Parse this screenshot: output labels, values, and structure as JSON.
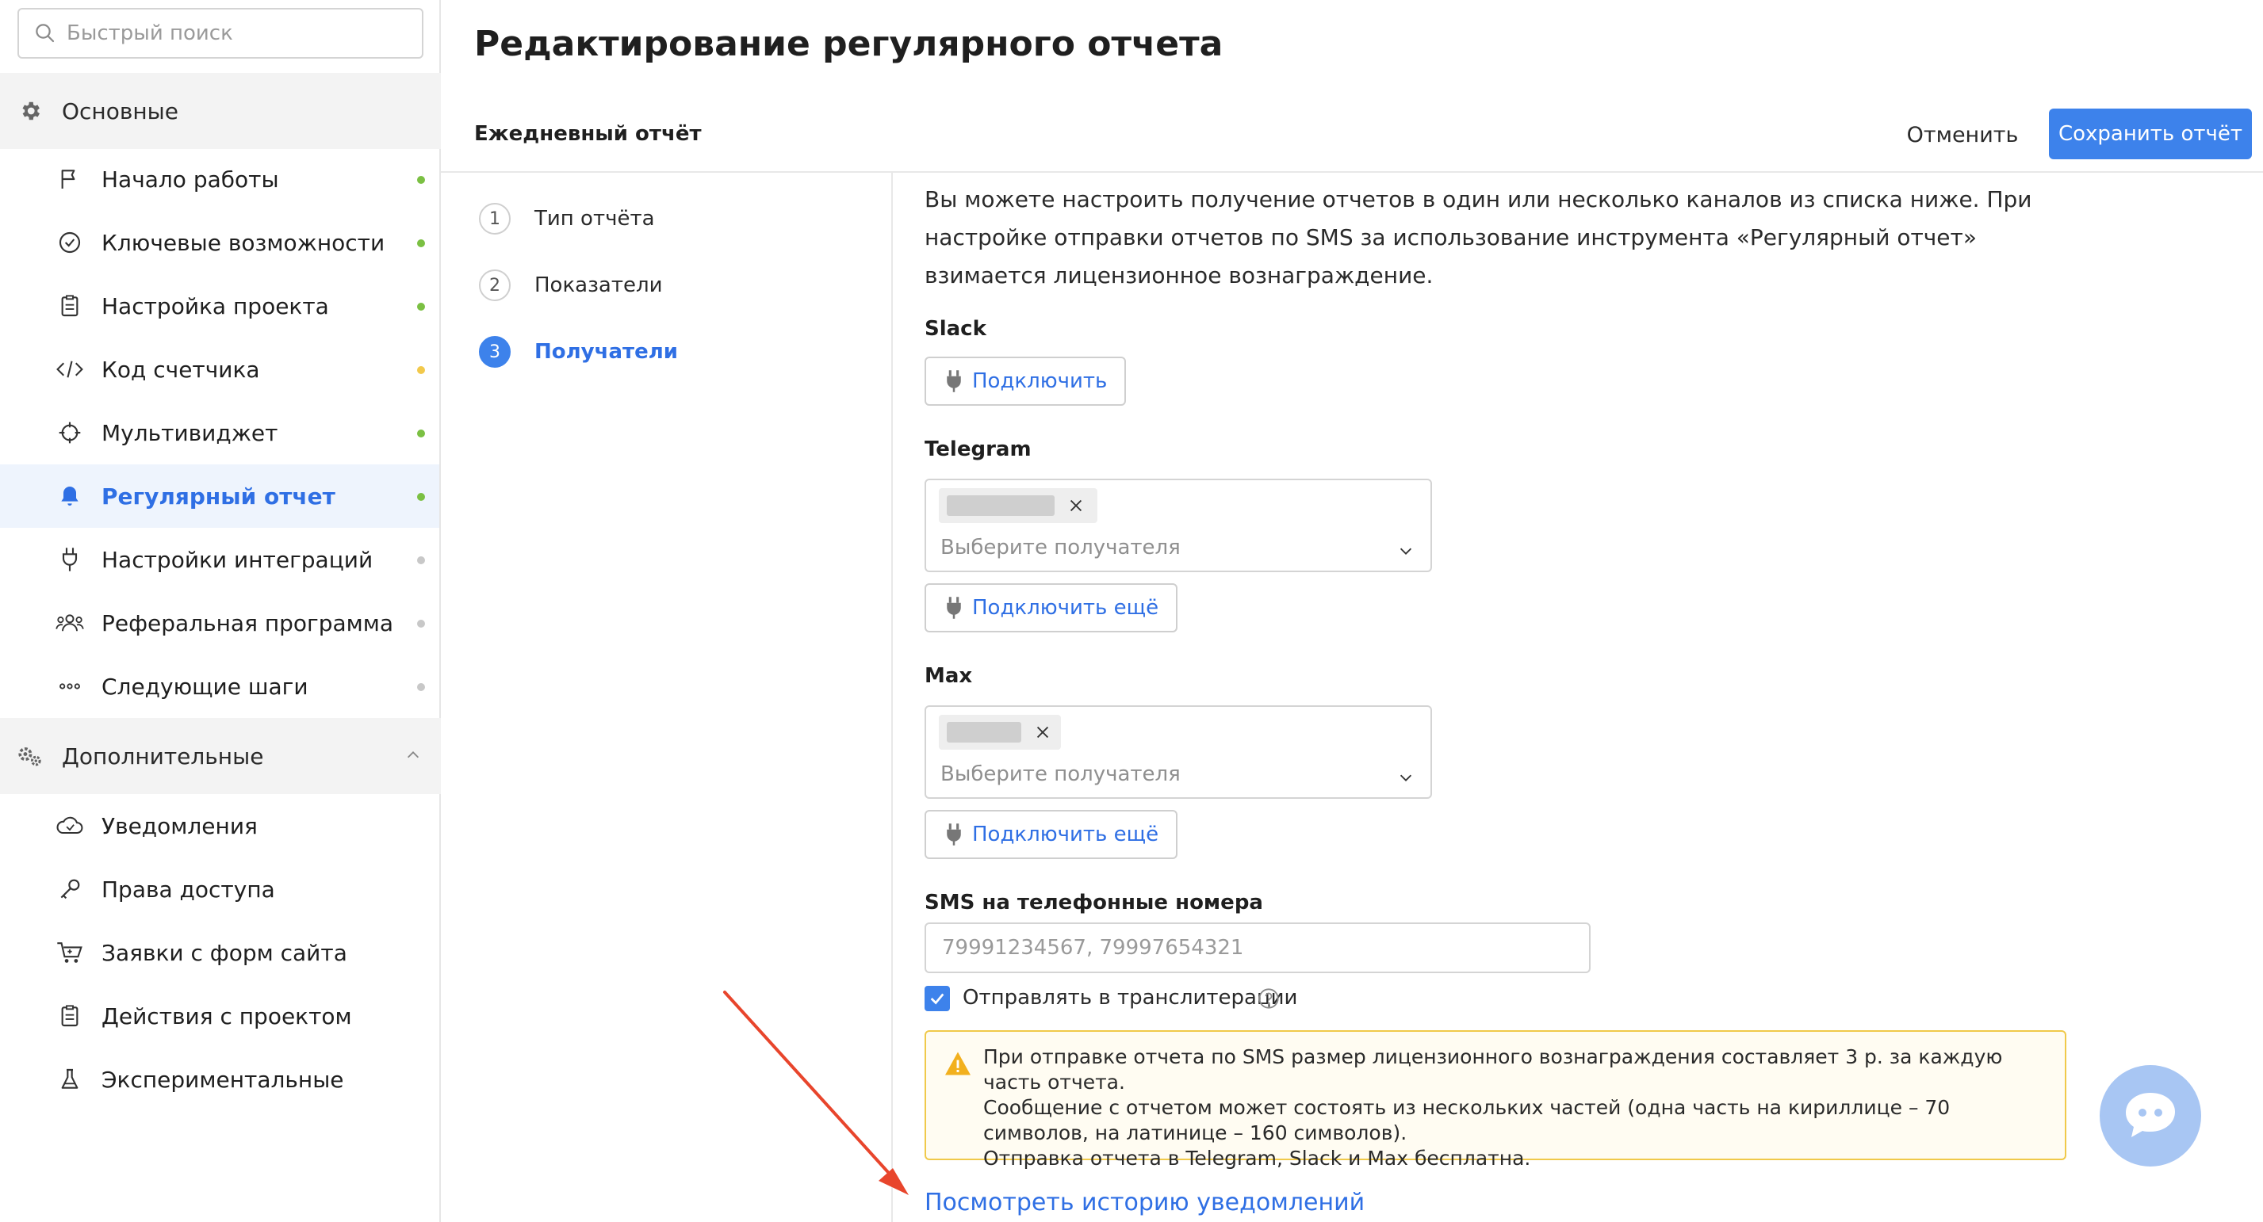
{
  "sidebar": {
    "search_placeholder": "Быстрый поиск",
    "section_main": "Основные",
    "section_extra": "Дополнительные",
    "main_items": [
      {
        "label": "Начало работы",
        "icon": "flag-icon",
        "dot": "#7bc043"
      },
      {
        "label": "Ключевые возможности",
        "icon": "check-circle-icon",
        "dot": "#7bc043"
      },
      {
        "label": "Настройка проекта",
        "icon": "clipboard-icon",
        "dot": "#7bc043"
      },
      {
        "label": "Код счетчика",
        "icon": "code-icon",
        "dot": "#f2c94c"
      },
      {
        "label": "Мультивиджет",
        "icon": "crosshair-icon",
        "dot": "#7bc043"
      },
      {
        "label": "Регулярный отчет",
        "icon": "bell-icon",
        "dot": "#7bc043",
        "active": true
      },
      {
        "label": "Настройки интеграций",
        "icon": "plug-icon",
        "dot": "#c8c8c8"
      },
      {
        "label": "Реферальная программа",
        "icon": "users-icon",
        "dot": "#c8c8c8"
      },
      {
        "label": "Следующие шаги",
        "icon": "dots-icon",
        "dot": "#c8c8c8"
      }
    ],
    "extra_items": [
      {
        "label": "Уведомления",
        "icon": "cloud-icon"
      },
      {
        "label": "Права доступа",
        "icon": "key-icon"
      },
      {
        "label": "Заявки с форм сайта",
        "icon": "cart-icon"
      },
      {
        "label": "Действия с проектом",
        "icon": "clipboard-icon"
      },
      {
        "label": "Экспериментальные",
        "icon": "flask-icon"
      }
    ]
  },
  "header": {
    "title": "Редактирование регулярного отчета",
    "subtitle": "Ежедневный отчёт",
    "cancel_label": "Отменить",
    "save_label": "Сохранить отчёт"
  },
  "steps": [
    {
      "num": "1",
      "label": "Тип отчёта"
    },
    {
      "num": "2",
      "label": "Показатели"
    },
    {
      "num": "3",
      "label": "Получатели",
      "active": true
    }
  ],
  "content": {
    "intro": "Вы можете настроить получение отчетов в один или несколько каналов из списка ниже. При настройке отправки отчетов по SMS за использование инструмента «Регулярный отчет» взимается лицензионное вознаграждение.",
    "slack_label": "Slack",
    "connect_label": "Подключить",
    "telegram_label": "Telegram",
    "select_placeholder": "Выберите получателя",
    "connect_more_label": "Подключить ещё",
    "max_label": "Max",
    "sms_label": "SMS на телефонные номера",
    "sms_placeholder": "79991234567, 79997654321",
    "translit_label": "Отправлять в транслитерации",
    "warning_lines": [
      "При отправке отчета по SMS размер лицензионного вознаграждения составляет 3 р. за каждую часть отчета.",
      "Сообщение с отчетом может состоять из нескольких частей (одна часть на кириллице – 70 символов, на латинице – 160 символов).",
      "Отправка отчета в Telegram, Slack и Max бесплатна."
    ],
    "history_link": "Посмотреть историю уведомлений"
  },
  "colors": {
    "accent": "#3d82eb",
    "warning_border": "#f0c94a",
    "annotation_arrow": "#e8452c"
  }
}
